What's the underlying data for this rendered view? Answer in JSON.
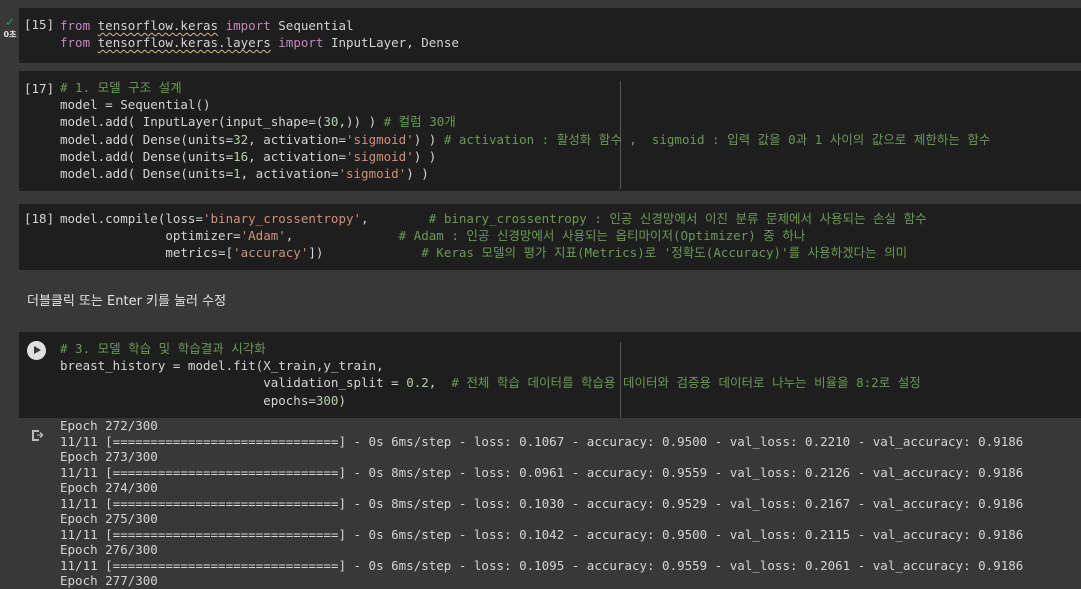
{
  "cell15": {
    "exec_label": "[15]",
    "status_time": "0초",
    "line1": {
      "k1": "from",
      "mod": "tensorflow.keras",
      "k2": "import",
      "name": "Sequential"
    },
    "line2": {
      "k1": "from",
      "mod": "tensorflow.keras.layers",
      "k2": "import",
      "name": "InputLayer, Dense"
    }
  },
  "cell17": {
    "exec_label": "[17]",
    "lines": [
      {
        "comment": "# 1. 모델 구조 설계"
      },
      {
        "code": "model = Sequential()"
      },
      {
        "pre": "model.add( InputLayer(input_shape=(",
        "num": "30",
        "mid": ",)) ) ",
        "comment": "# 컬럼 30개"
      },
      {
        "pre": "model.add( Dense(units=",
        "num": "32",
        "mid": ", activation=",
        "str": "'sigmoid'",
        "post": ") ) ",
        "comment": "# activation : 활성화 함수 ,  sigmoid : 입력 값을 0과 1 사이의 값으로 제한하는 함수"
      },
      {
        "pre": "model.add( Dense(units=",
        "num": "16",
        "mid": ", activation=",
        "str": "'sigmoid'",
        "post": ") )"
      },
      {
        "pre": "model.add( Dense(units=",
        "num": "1",
        "mid": ", activation=",
        "str": "'sigmoid'",
        "post": ") )"
      }
    ]
  },
  "cell18": {
    "exec_label": "[18]",
    "lines": [
      {
        "pre": "model.compile(loss=",
        "str": "'binary_crossentropy'",
        "post": ",        ",
        "comment": "# binary_crossentropy : 인공 신경망에서 이진 분류 문제에서 사용되는 손실 함수"
      },
      {
        "pre": "              optimizer=",
        "str": "'Adam'",
        "post": ",              ",
        "comment": "# Adam : 인공 신경망에서 사용되는 옵티마이저(Optimizer) 중 하나"
      },
      {
        "pre": "              metrics=[",
        "str": "'accuracy'",
        "post": "])             ",
        "comment": "# Keras 모델의 평가 지표(Metrics)로 '정확도(Accuracy)'를 사용하겠다는 의미"
      }
    ]
  },
  "text_cell": "더블클릭 또는 Enter 키를 눌러 수정",
  "cell_train": {
    "lines": [
      {
        "comment": "# 3. 모델 학습 및 학습결과 시각화"
      },
      {
        "code": "breast_history = model.fit(X_train,y_train,"
      },
      {
        "pre": "                           validation_split = ",
        "num": "0.2",
        "post": ",  ",
        "comment": "# 전체 학습 데이터를 학습용 데이터와 검증용 데이터로 나누는 비율을 8:2로 설정"
      },
      {
        "pre": "                           epochs=",
        "num": "300",
        "post": ")"
      }
    ],
    "output": [
      "Epoch 272/300",
      "11/11 [==============================] - 0s 6ms/step - loss: 0.1067 - accuracy: 0.9500 - val_loss: 0.2210 - val_accuracy: 0.9186",
      "Epoch 273/300",
      "11/11 [==============================] - 0s 8ms/step - loss: 0.0961 - accuracy: 0.9559 - val_loss: 0.2126 - val_accuracy: 0.9186",
      "Epoch 274/300",
      "11/11 [==============================] - 0s 8ms/step - loss: 0.1030 - accuracy: 0.9529 - val_loss: 0.2167 - val_accuracy: 0.9186",
      "Epoch 275/300",
      "11/11 [==============================] - 0s 6ms/step - loss: 0.1042 - accuracy: 0.9500 - val_loss: 0.2115 - val_accuracy: 0.9186",
      "Epoch 276/300",
      "11/11 [==============================] - 0s 6ms/step - loss: 0.1095 - accuracy: 0.9559 - val_loss: 0.2061 - val_accuracy: 0.9186",
      "Epoch 277/300"
    ]
  },
  "colors": {
    "keyword": "#c586c0",
    "string": "#ce9178",
    "comment": "#6a9955",
    "number": "#b5cea8",
    "success": "#21a366"
  }
}
